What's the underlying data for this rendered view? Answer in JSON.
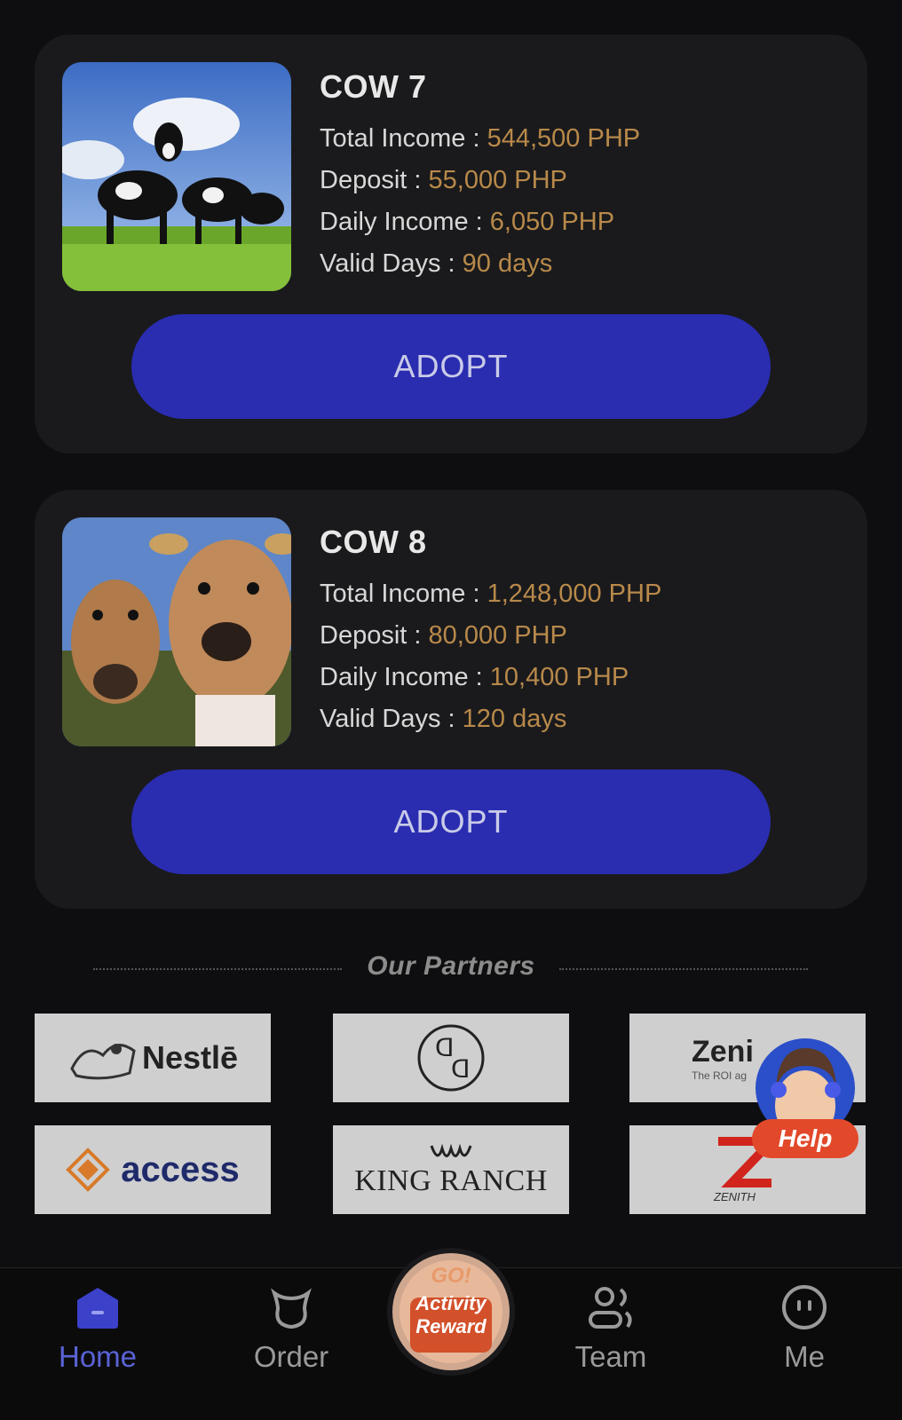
{
  "products": [
    {
      "name": "COW 7",
      "rows": [
        {
          "label": "Total Income : ",
          "value": "544,500 PHP"
        },
        {
          "label": "Deposit : ",
          "value": "55,000 PHP"
        },
        {
          "label": "Daily Income : ",
          "value": "6,050 PHP"
        },
        {
          "label": "Valid Days : ",
          "value": "90 days"
        }
      ],
      "button": "ADOPT"
    },
    {
      "name": "COW 8",
      "rows": [
        {
          "label": "Total Income : ",
          "value": "1,248,000 PHP"
        },
        {
          "label": "Deposit : ",
          "value": "80,000 PHP"
        },
        {
          "label": "Daily Income : ",
          "value": "10,400 PHP"
        },
        {
          "label": "Valid Days : ",
          "value": "120 days"
        }
      ],
      "button": "ADOPT"
    }
  ],
  "partners": {
    "title": "Our Partners",
    "logos": [
      "Nestlē",
      "",
      "Zeni",
      "access",
      "KING RANCH",
      "ZENITH"
    ],
    "zenith_sub": "The ROI ag"
  },
  "help": {
    "label": "Help"
  },
  "activity": {
    "line1": "GO!",
    "line2": "Activity",
    "line3": "Reward"
  },
  "nav": {
    "home": "Home",
    "order": "Order",
    "team": "Team",
    "me": "Me"
  },
  "colors": {
    "accent": "#2a2db0",
    "value": "#b8894a",
    "active_nav": "#5a63d6"
  }
}
